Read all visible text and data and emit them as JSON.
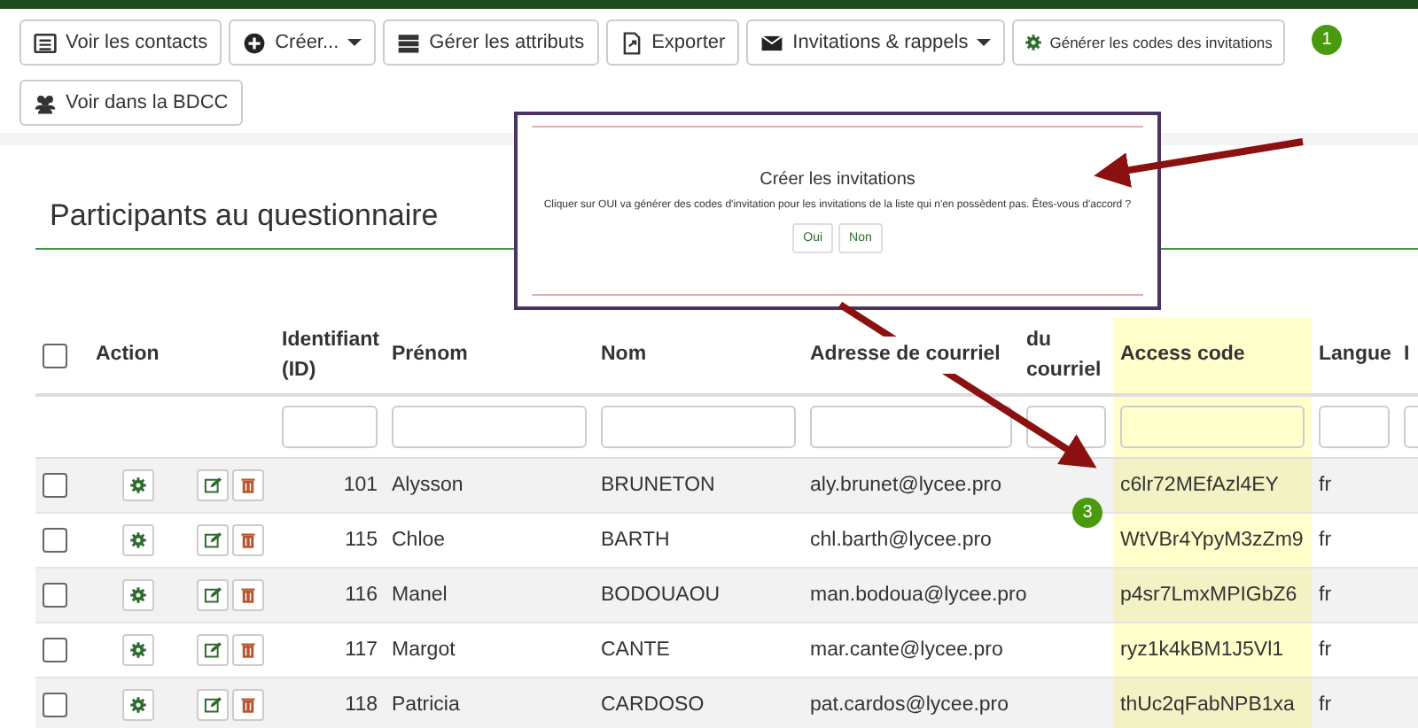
{
  "toolbar": [
    {
      "label": "Voir les contacts",
      "kind": "normal",
      "dropdown": false
    },
    {
      "label": "Créer...",
      "kind": "normal",
      "dropdown": true
    },
    {
      "label": "Gérer les attributs",
      "kind": "normal",
      "dropdown": false
    },
    {
      "label": "Exporter",
      "kind": "normal",
      "dropdown": false
    },
    {
      "label": "Invitations & rappels",
      "kind": "normal",
      "dropdown": true
    },
    {
      "label": "Générer les codes des invitations",
      "kind": "small",
      "dropdown": false
    },
    {
      "label": "Voir dans la BDCC",
      "kind": "normal",
      "dropdown": false
    }
  ],
  "callouts": [
    {
      "number": "1"
    },
    {
      "number": "3"
    }
  ],
  "heading": "Participants au questionnaire",
  "dialog": {
    "title": "Créer les invitations",
    "message": "Cliquer sur OUI va générer des codes d'invitation pour les invitations de la liste qui n'en possèdent pas. Êtes-vous d'accord ?",
    "buttons": [
      "Oui",
      "Non"
    ]
  },
  "table": {
    "select_all": {
      "checked": false
    },
    "action_header": "Action",
    "columns": [
      {
        "label": "Identifiant (ID)",
        "highlighted": false
      },
      {
        "label": "Prénom",
        "highlighted": false
      },
      {
        "label": "Nom",
        "highlighted": false
      },
      {
        "label": "Adresse de courriel",
        "highlighted": false
      },
      {
        "label": "du courriel",
        "highlighted": false
      },
      {
        "label": "Access code",
        "highlighted": true
      },
      {
        "label": "Langue",
        "highlighted": false
      },
      {
        "label": "I",
        "highlighted": false
      }
    ],
    "rows": [
      {
        "checked": false,
        "cells": [
          "101",
          "Alysson",
          "BRUNETON",
          "aly.brunet@lycee.pro",
          "",
          "c6lr72MEfAzl4EY",
          "fr"
        ]
      },
      {
        "checked": false,
        "cells": [
          "115",
          "Chloe",
          "BARTH",
          "chl.barth@lycee.pro",
          "",
          "WtVBr4YpyM3zZm9",
          "fr"
        ]
      },
      {
        "checked": false,
        "cells": [
          "116",
          "Manel",
          "BODOUAOU",
          "man.bodoua@lycee.pro",
          "",
          "p4sr7LmxMPIGbZ6",
          "fr"
        ]
      },
      {
        "checked": false,
        "cells": [
          "117",
          "Margot",
          "CANTE",
          "mar.cante@lycee.pro",
          "",
          "ryz1k4kBM1J5Vl1",
          "fr"
        ]
      },
      {
        "checked": false,
        "cells": [
          "118",
          "Patricia",
          "CARDOSO",
          "pat.cardos@lycee.pro",
          "",
          "thUc2qFabNPB1xa",
          "fr"
        ]
      }
    ]
  }
}
